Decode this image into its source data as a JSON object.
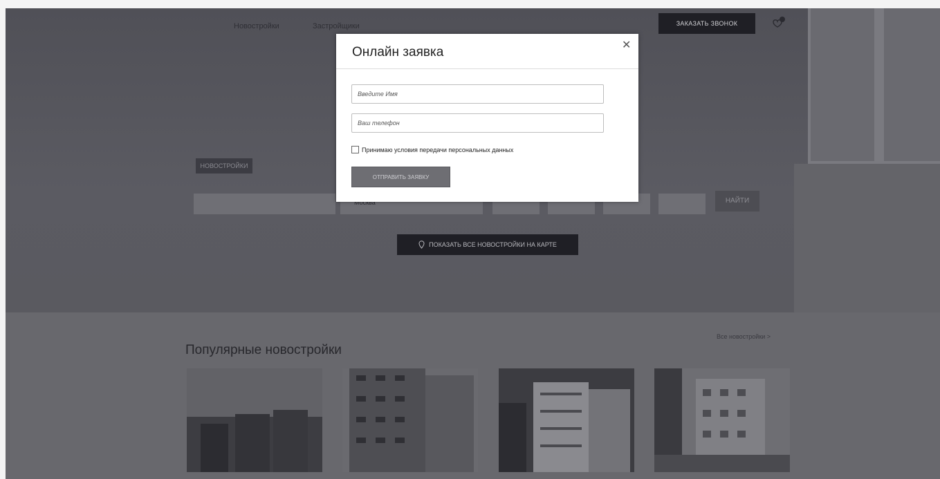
{
  "header": {
    "nav_items": [
      "Новостройки",
      "Застройщики"
    ],
    "callback_button": "ЗАКАЗАТЬ ЗВОНОК",
    "favorites_icon": "heart-icon"
  },
  "hero": {
    "label": "НОВОСТРОЙКИ",
    "search_city": "Москва",
    "search_button": "НАЙТИ",
    "map_button": "ПОКАЗАТЬ ВСЕ НОВОСТРОЙКИ НА КАРТЕ",
    "map_icon": "location-pin-icon"
  },
  "popular": {
    "title": "Популярные новостройки",
    "all_link": "Все новостройки  >"
  },
  "modal": {
    "title": "Онлайн заявка",
    "close_icon": "close-icon",
    "name_placeholder": "Введите Имя",
    "phone_placeholder": "Ваш телефон",
    "consent_label": "Принимаю условия передачи персональных данных",
    "submit_button": "ОТПРАВИТЬ ЗАЯВКУ"
  }
}
